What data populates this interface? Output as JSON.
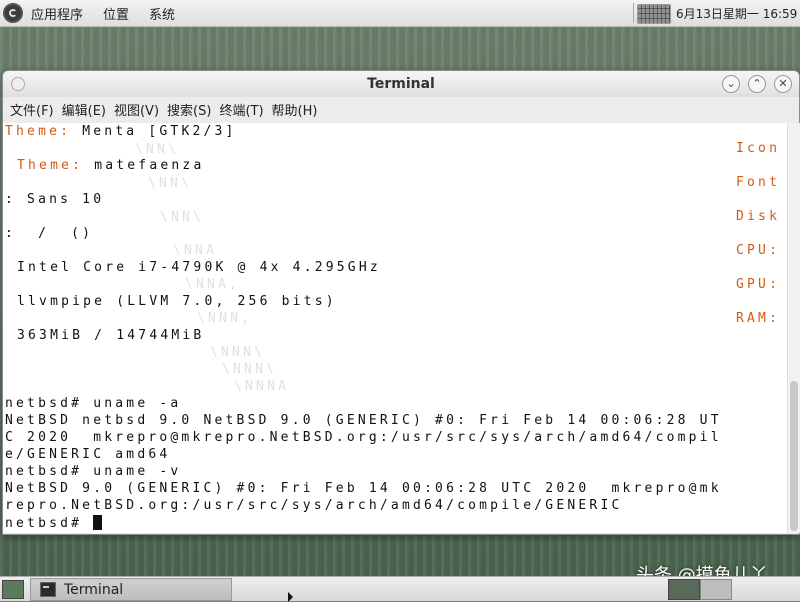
{
  "top_panel": {
    "menus": [
      "应用程序",
      "位置",
      "系统"
    ],
    "clock": "6月13日星期一 16:59"
  },
  "window": {
    "title": "Terminal",
    "menu": [
      "文件(F)",
      "编辑(E)",
      "视图(V)",
      "搜索(S)",
      "终端(T)",
      "帮助(H)"
    ]
  },
  "terminal": {
    "neofetch": {
      "theme_label": "Theme:",
      "theme_value": "Menta [GTK2/3]",
      "icon_theme_label": "Theme:",
      "icon_theme_value": "matefaenza",
      "font_value": ": Sans 10",
      "disk_value": ":  /  ()",
      "cpu_value": "Intel Core i7-4790K @ 4x 4.295GHz",
      "gpu_value": "llvmpipe (LLVM 7.0, 256 bits)",
      "ram_value": "363MiB / 14744MiB",
      "right_labels": [
        "Icon",
        "Font",
        "Disk",
        "CPU:",
        "GPU:",
        "RAM:"
      ],
      "ghost_art": [
        "\\NN\\",
        "\\NN\\",
        "\\NN\\",
        "\\NNA",
        "\\NNA,",
        "\\NNN,",
        "\\NNN\\",
        "\\NNN\\",
        "\\NNNA"
      ]
    },
    "lines": [
      "netbsd# uname -a",
      "NetBSD netbsd 9.0 NetBSD 9.0 (GENERIC) #0: Fri Feb 14 00:06:28 UT",
      "C 2020  mkrepro@mkrepro.NetBSD.org:/usr/src/sys/arch/amd64/compil",
      "e/GENERIC amd64",
      "netbsd# uname -v",
      "NetBSD 9.0 (GENERIC) #0: Fri Feb 14 00:06:28 UTC 2020  mkrepro@mk",
      "repro.NetBSD.org:/usr/src/sys/arch/amd64/compile/GENERIC",
      "netbsd# "
    ]
  },
  "taskbar": {
    "task_label": "Terminal"
  },
  "watermark": "头条 @摸鱼儿丫"
}
